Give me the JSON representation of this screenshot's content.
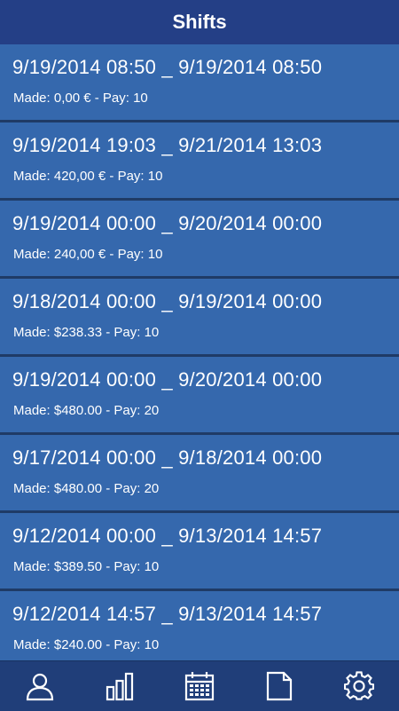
{
  "header": {
    "title": "Shifts"
  },
  "shifts": [
    {
      "dates": "9/19/2014 08:50 _ 9/19/2014 08:50",
      "info": "Made: 0,00 € - Pay: 10"
    },
    {
      "dates": "9/19/2014 19:03 _ 9/21/2014 13:03",
      "info": "Made: 420,00 € - Pay: 10"
    },
    {
      "dates": "9/19/2014 00:00 _ 9/20/2014 00:00",
      "info": "Made: 240,00 € - Pay: 10"
    },
    {
      "dates": "9/18/2014 00:00 _ 9/19/2014 00:00",
      "info": "Made: $238.33 - Pay: 10"
    },
    {
      "dates": "9/19/2014 00:00 _ 9/20/2014 00:00",
      "info": "Made: $480.00 - Pay: 20"
    },
    {
      "dates": "9/17/2014 00:00 _ 9/18/2014 00:00",
      "info": "Made: $480.00 - Pay: 20"
    },
    {
      "dates": "9/12/2014 00:00 _ 9/13/2014 14:57",
      "info": "Made: $389.50 - Pay: 10"
    },
    {
      "dates": "9/12/2014 14:57 _ 9/13/2014 14:57",
      "info": "Made: $240.00 - Pay: 10"
    }
  ],
  "nav": [
    {
      "icon": "user-icon"
    },
    {
      "icon": "bar-chart-icon"
    },
    {
      "icon": "calendar-icon"
    },
    {
      "icon": "document-icon"
    },
    {
      "icon": "gear-icon"
    }
  ],
  "colors": {
    "header_bg": "#243f86",
    "row_bg": "#3568ad",
    "row_divider": "#1f3b66",
    "nav_bg": "#203e79",
    "text": "#ffffff"
  }
}
